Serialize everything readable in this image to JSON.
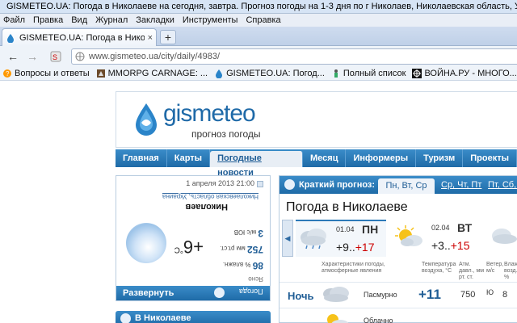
{
  "window": {
    "title": "GISMETEO.UA: Погода в Николаеве на сегодня, завтра. Прогноз погоды на 1-3 дня по г Николаев, Николаевская область, Украина - Mozilla Fire"
  },
  "menu": {
    "items": [
      "Файл",
      "Правка",
      "Вид",
      "Журнал",
      "Закладки",
      "Инструменты",
      "Справка"
    ]
  },
  "tabs": [
    {
      "label": "GISMETEO.UA: Погода в Николаеве на ...",
      "close": "×"
    }
  ],
  "new_tab_label": "+",
  "nav": {
    "back": "←",
    "forward": "→",
    "url": "www.gismeteo.ua/city/daily/4983/"
  },
  "bookmarks": [
    "Вопросы и ответы",
    "MMORPG CARNAGE: ...",
    "GISMETEO.UA: Погод...",
    "Полный список",
    "ВОЙНА.РУ - МНОГО..."
  ],
  "site": {
    "logo": "gismeteo",
    "tagline": "прогноз погоды",
    "nav": [
      "Главная",
      "Карты",
      "Погодные новости",
      "Месяц",
      "Информеры",
      "Туризм",
      "Проекты"
    ],
    "nav_active_index": 2
  },
  "current": {
    "datetime": "1 апреля 2013 21:00",
    "condition": "Ясно",
    "humidity_value": "86",
    "humidity_unit": "% влажн.",
    "pressure_value": "752",
    "pressure_unit": "мм рт.ст.",
    "wind_value": "3",
    "wind_unit": "м/с",
    "wind_dir": "ЮВ",
    "temperature": "+6",
    "temp_unit": "°C",
    "city": "Николаев",
    "region": "Николаевская область, Украина",
    "expand_label": "Развернуть",
    "weather_label": "Погода"
  },
  "in_city": {
    "label": "В Николаеве"
  },
  "forecast": {
    "header": "Краткий прогноз:",
    "tab_active": "Пн, Вт, Ср",
    "tab_2": "Ср, Чт, Пт",
    "tab_3": "Пт, Сб, Вс",
    "title": "Погода в Николаеве",
    "days": [
      {
        "date": "01.04",
        "dow": "ПН",
        "min": "+9..",
        "max": "+17",
        "icon": "cloud-rain-icon"
      },
      {
        "date": "02.04",
        "dow": "ВТ",
        "min": "+3..",
        "max": "+15",
        "icon": "sun-cloud-icon"
      }
    ],
    "headers": {
      "cond": "Характеристики погоды, атмосферные явления",
      "temp": "Температура воздуха, °C",
      "pres": "Атм. давл., мм рт. ст.",
      "wind": "Ветер, м/с",
      "hum": "Влажн. возд., %"
    },
    "rows": [
      {
        "label": "Ночь",
        "cond": "Пасмурно",
        "temp": "+11",
        "pres": "750",
        "wind_dir": "Ю",
        "wind": "8"
      },
      {
        "label": "",
        "cond": "Облачно",
        "temp": "",
        "pres": "",
        "wind_dir": "",
        "wind": ""
      }
    ]
  }
}
